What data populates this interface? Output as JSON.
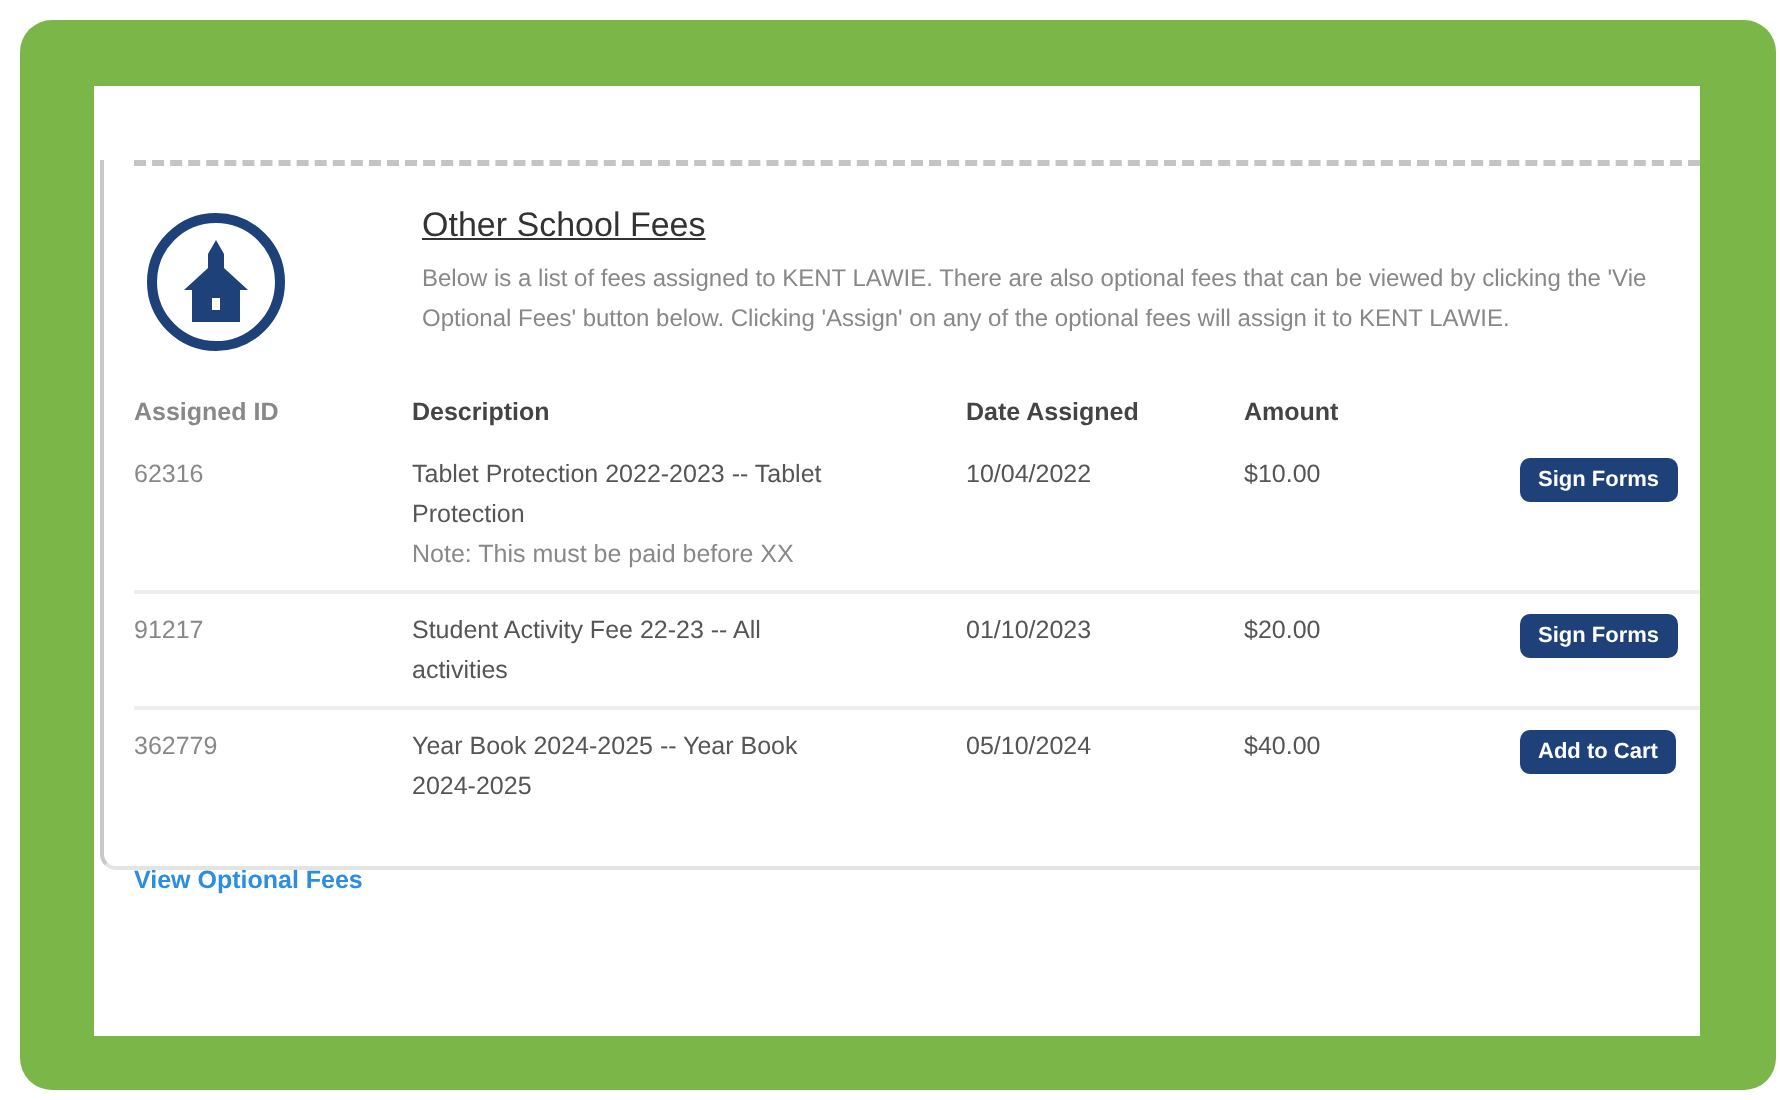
{
  "section": {
    "title": "Other School Fees",
    "description_lines": [
      "Below is a list of fees assigned to KENT LAWIE. There are also optional fees that can be viewed by clicking the 'Vie",
      "Optional Fees' button below. Clicking 'Assign' on any of the optional fees will assign it to KENT LAWIE."
    ]
  },
  "table": {
    "columns": [
      "Assigned ID",
      "Description",
      "Date Assigned",
      "Amount"
    ],
    "rows": [
      {
        "id": "62316",
        "description": "Tablet Protection 2022-2023 -- Tablet Protection",
        "note": "Note: This must be paid before XX",
        "date": "10/04/2022",
        "amount": "$10.00",
        "action": "Sign Forms"
      },
      {
        "id": "91217",
        "description": "Student Activity Fee 22-23 -- All activities",
        "date": "01/10/2023",
        "amount": "$20.00",
        "action": "Sign Forms"
      },
      {
        "id": "362779",
        "description": "Year Book 2024-2025 -- Year Book 2024-2025",
        "date": "05/10/2024",
        "amount": "$40.00",
        "action": "Add to Cart"
      }
    ]
  },
  "link": "View Optional Fees"
}
